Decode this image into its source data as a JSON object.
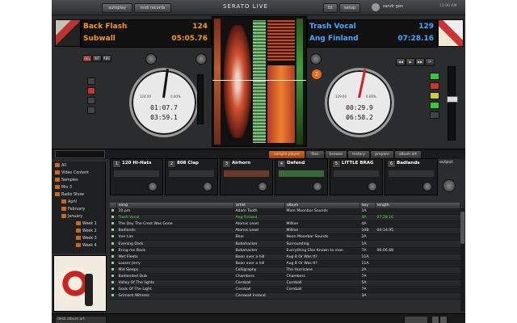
{
  "topbar": {
    "btn_left": "autoplay",
    "btn_right": "midi records",
    "brand": "SERATO LIVE",
    "btn_r1": "ttt",
    "btn_r2": "setup",
    "user": "sandr gen",
    "clock": "12:00 AM"
  },
  "deck_left": {
    "track": "Back Flash",
    "artist": "Subwall",
    "bpm": "124",
    "remaining": "05:05.76",
    "elapsed": "01:07.7",
    "remain_platter": "03:59.1",
    "pitch_bpm": "124.00",
    "pitch_pct": "0.00%"
  },
  "deck_right": {
    "track": "Trash Vocal",
    "artist": "Ang Finland",
    "bpm": "129",
    "remaining": "07:28.16",
    "elapsed": "00:29.9",
    "remain_platter": "06:58.2",
    "pitch_bpm": "129.00",
    "pitch_pct": "0.00%",
    "deck_number": "2"
  },
  "library_tabs": [
    "sample player",
    "files",
    "browse",
    "history",
    "prepare",
    "album art"
  ],
  "samples": [
    {
      "slot": "1",
      "name": "120 Hi-Hats"
    },
    {
      "slot": "2",
      "name": "808 Clap"
    },
    {
      "slot": "3",
      "name": "Airhorn"
    },
    {
      "slot": "4",
      "name": "Defend"
    },
    {
      "slot": "5",
      "name": "LITTLE BRAG"
    },
    {
      "slot": "6",
      "name": "Badlands"
    }
  ],
  "output_label": "output",
  "sidebar": {
    "items": [
      {
        "label": "All",
        "indent": 0
      },
      {
        "label": "Video Content",
        "indent": 0
      },
      {
        "label": "Samples",
        "indent": 0
      },
      {
        "label": "Mix 3",
        "indent": 0
      },
      {
        "label": "Radio Show",
        "indent": 0
      },
      {
        "label": "April",
        "indent": 1
      },
      {
        "label": "February",
        "indent": 1
      },
      {
        "label": "January",
        "indent": 1
      },
      {
        "label": "Week 1",
        "indent": 2
      },
      {
        "label": "Week 2",
        "indent": 2
      },
      {
        "label": "Week 3",
        "indent": 2
      },
      {
        "label": "Week 4",
        "indent": 2
      }
    ]
  },
  "table": {
    "columns": [
      "song",
      "artist",
      "album",
      "key",
      "length"
    ],
    "rows": [
      {
        "song": "10 pm",
        "artist": "Adam Tooth",
        "album": "More Moonbar Sounds",
        "key": "1A",
        "length": "",
        "state": ""
      },
      {
        "song": "Trash Vocal",
        "artist": "Ang Finland",
        "album": "",
        "key": "4A",
        "length": "07:28.16",
        "state": "playing"
      },
      {
        "song": "The Day The Crest Was Gone",
        "artist": "Atomic Lead",
        "album": "Million",
        "key": "4A",
        "length": "",
        "state": ""
      },
      {
        "song": "Badlands",
        "artist": "Atomic Lead",
        "album": "Million",
        "key": "10B",
        "length": "04:14.95",
        "state": ""
      },
      {
        "song": "Iron Lan",
        "artist": "Blue",
        "album": "Neon Moonbar Sounds",
        "key": "2A",
        "length": "",
        "state": ""
      },
      {
        "song": "Evening Dark",
        "artist": "Bobahacker",
        "album": "Surrounding",
        "key": "1A",
        "length": "",
        "state": ""
      },
      {
        "song": "Bring me Back",
        "artist": "Bobahacker",
        "album": "Everything Else Known to man",
        "key": "7A",
        "length": "06:06.68",
        "state": ""
      },
      {
        "song": "Wet Fleets",
        "artist": "Boon over a hill",
        "album": "Aug 8 Or Was It?",
        "key": "11A",
        "length": "",
        "state": ""
      },
      {
        "song": "Looser Jerry",
        "artist": "Boon over a hill",
        "album": "Aug 8 Or Was It?",
        "key": "11A",
        "length": "",
        "state": ""
      },
      {
        "song": "Mid Sleeps",
        "artist": "Calligraphy",
        "album": "The Hurricane",
        "key": "2A",
        "length": "",
        "state": ""
      },
      {
        "song": "Badlanded Dub",
        "artist": "Chambers",
        "album": "Chambers",
        "key": "7A",
        "length": "",
        "state": ""
      },
      {
        "song": "Valley Of The lights",
        "artist": "Cornball",
        "album": "Cornball",
        "key": "5A",
        "length": "",
        "state": ""
      },
      {
        "song": "Gods Of The Light",
        "artist": "Cornball",
        "album": "Cornball",
        "key": "7A",
        "length": "",
        "state": ""
      },
      {
        "song": "Grimard Witness",
        "artist": "Cornwall Ireland",
        "album": "",
        "key": "3A",
        "length": "",
        "state": ""
      }
    ]
  },
  "status": {
    "search_placeholder": "",
    "album_label": "desk album art"
  }
}
